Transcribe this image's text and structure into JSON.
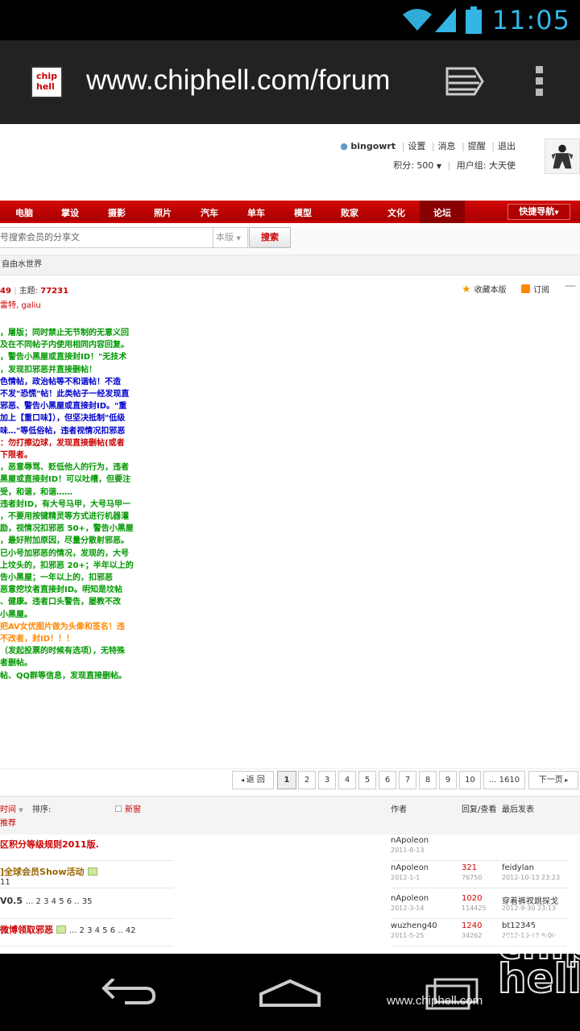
{
  "status": {
    "time": "11:05"
  },
  "browser": {
    "url": "www.chiphell.com/forum",
    "favicon_text": "chip hell"
  },
  "user": {
    "name": "bingowrt",
    "links": [
      "设置",
      "消息",
      "提醒",
      "退出"
    ],
    "points_label": "积分: 500",
    "group_label": "用户组: 大天使"
  },
  "nav": {
    "items": [
      "电脑",
      "掌设",
      "摄影",
      "照片",
      "汽车",
      "单车",
      "模型",
      "败家",
      "文化",
      "论坛"
    ],
    "quick_nav": "快捷导航"
  },
  "search": {
    "placeholder": "号搜索会员的分享文",
    "scope": "本版",
    "button": "搜索"
  },
  "breadcrumb": "自由水世界",
  "forum": {
    "stats_prefix": "49",
    "topics_label": "主题: ",
    "topics_value": "77231",
    "moderators": "雷特, galiu",
    "favorite": "收藏本版",
    "subscribe": "订阅",
    "rules": [
      {
        "text": "，屠版；同时禁止无节制的无意义回",
        "color": "g"
      },
      {
        "text": "及在不同帖子内使用相同内容回复。",
        "color": "g"
      },
      {
        "text": "，警告小黑屋或直接封ID！\"无技术",
        "color": "g"
      },
      {
        "text": "，发现扣邪恶并直接删帖！",
        "color": "g"
      },
      {
        "text": "色情帖，政治帖等不和谐帖！不造",
        "color": "bl"
      },
      {
        "text": "不发\"恐慌\"帖！此类帖子一经发现直",
        "color": "bl"
      },
      {
        "text": "邪恶、警告小黑屋或直接封ID。\"重",
        "color": "bl"
      },
      {
        "text": "加上【重口味】），但坚决抵制\"低级",
        "color": "bl"
      },
      {
        "text": "味…\"等低俗帖，违者视情况扣邪恶",
        "color": "bl"
      },
      {
        "text": "：勿打擦边球，发现直接删帖(或者",
        "color": "r"
      },
      {
        "text": "下限者。",
        "color": "r"
      },
      {
        "text": "，恶意辱骂、贬低他人的行为，违者",
        "color": "g"
      },
      {
        "text": "黑屋或直接封ID！可以吐槽，但要注",
        "color": "g"
      },
      {
        "text": "受，和谐，和谐……",
        "color": "g"
      },
      {
        "text": "违者封ID，有大号马甲，大号马甲一",
        "color": "g"
      },
      {
        "text": "，不要用按键精灵等方式进行机器灌",
        "color": "g"
      },
      {
        "text": "励，视情况扣邪恶 50+，警告小黑屋",
        "color": "g"
      },
      {
        "text": "",
        "color": "g"
      },
      {
        "text": "，最好附加原因，尽量分散射邪恶。",
        "color": "g"
      },
      {
        "text": "已小号加邪恶的情况，发现的，大号",
        "color": "g"
      },
      {
        "text": "",
        "color": "g"
      },
      {
        "text": "上坟头的，扣邪恶 20+；半年以上的",
        "color": "g"
      },
      {
        "text": "告小黑屋；一年以上的，扣邪恶",
        "color": "g"
      },
      {
        "text": "恶意挖坟者直接封ID。明知是坟帖",
        "color": "g"
      },
      {
        "text": "",
        "color": "g"
      },
      {
        "text": "、健康。违者口头警告，屡教不改",
        "color": "g"
      },
      {
        "text": "小黑屋。",
        "color": "g"
      },
      {
        "text": "把AV女优图片做为头像和签名！违",
        "color": "o"
      },
      {
        "text": "不改者，封ID！！！",
        "color": "o"
      },
      {
        "text": "（发起投票的时候有选项），无特殊",
        "color": "g"
      },
      {
        "text": "者删帖。",
        "color": "g"
      },
      {
        "text": "帖、QQ群等信息，发现直接删帖。",
        "color": "g"
      }
    ]
  },
  "pager": {
    "back": "返 回",
    "pages": [
      "1",
      "2",
      "3",
      "4",
      "5",
      "6",
      "7",
      "8",
      "9",
      "10",
      "... 1610"
    ],
    "next": "下一页"
  },
  "table_header": {
    "sort_time": "时间",
    "sort_label": "排序:",
    "new_window": "新窗",
    "recommend": "推荐",
    "author": "作者",
    "reply_view": "回复/查看",
    "last_post": "最后发表"
  },
  "threads": [
    {
      "title": "区积分等级规则2011版.",
      "pages": "",
      "author": "nApoleon",
      "date": "2011-8-13",
      "replies": "",
      "views": "",
      "last": "",
      "last_date": ""
    },
    {
      "title": "]全球会员Show活动",
      "pages": "11",
      "author": "nApoleon",
      "date": "2012-1-1",
      "replies": "321",
      "views": "76750",
      "last": "feidylan",
      "last_date": "2012-10-13 23:23"
    },
    {
      "title": "V0.5",
      "pages": "... 2 3 4 5 6 .. 35",
      "author": "nApoleon",
      "date": "2012-3-14",
      "replies": "1020",
      "views": "114425",
      "last": "穿着裤衩跳探戈",
      "last_date": "2012-9-30 23:13"
    },
    {
      "title": "微博领取邪恶",
      "pages": "... 2 3 4 5 6 .. 42",
      "author": "wuzheng40",
      "date": "2011-5-25",
      "replies": "1240",
      "views": "34262",
      "last": "bt12345",
      "last_date": "2012-10-13 6:00"
    }
  ],
  "watermark": {
    "url": "www.chiphell.com",
    "logo": "chip hell"
  },
  "colors": {
    "accent": "#cc0000",
    "status_blue": "#33b5e5"
  }
}
